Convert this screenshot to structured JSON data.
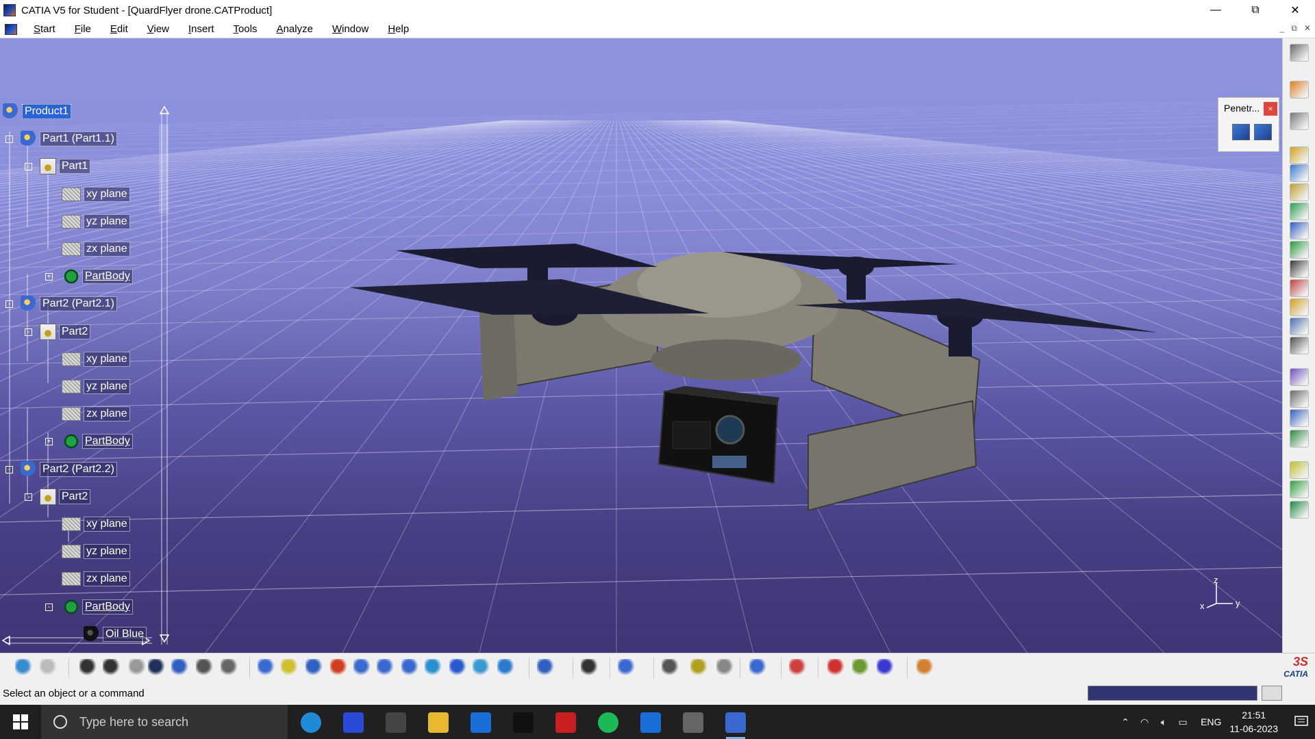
{
  "window": {
    "title": "CATIA V5 for Student - [QuardFlyer drone.CATProduct]",
    "minimize": "—",
    "restore": "⧉",
    "close": "✕"
  },
  "menu": {
    "items": [
      "Start",
      "File",
      "Edit",
      "View",
      "Insert",
      "Tools",
      "Analyze",
      "Window",
      "Help"
    ],
    "doc_minimize": "_",
    "doc_restore": "⧉",
    "doc_close": "✕"
  },
  "tree": {
    "nodes": [
      {
        "label": "Product1",
        "icon": "product-icon",
        "selected": true
      },
      {
        "label": "Part1 (Part1.1)",
        "icon": "product-icon"
      },
      {
        "label": "Part1",
        "icon": "part-icon"
      },
      {
        "label": "xy plane",
        "icon": "plane-icon"
      },
      {
        "label": "yz plane",
        "icon": "plane-icon"
      },
      {
        "label": "zx plane",
        "icon": "plane-icon"
      },
      {
        "label": "PartBody",
        "icon": "partbody-icon"
      },
      {
        "label": "Part2 (Part2.1)",
        "icon": "product-icon"
      },
      {
        "label": "Part2",
        "icon": "part-icon"
      },
      {
        "label": "xy plane",
        "icon": "plane-icon"
      },
      {
        "label": "yz plane",
        "icon": "plane-icon"
      },
      {
        "label": "zx plane",
        "icon": "plane-icon"
      },
      {
        "label": "PartBody",
        "icon": "partbody-icon"
      },
      {
        "label": "Part2 (Part2.2)",
        "icon": "product-icon"
      },
      {
        "label": "Part2",
        "icon": "part-icon"
      },
      {
        "label": "xy plane",
        "icon": "plane-icon"
      },
      {
        "label": "yz plane",
        "icon": "plane-icon"
      },
      {
        "label": "zx plane",
        "icon": "plane-icon"
      },
      {
        "label": "PartBody",
        "icon": "partbody-icon"
      },
      {
        "label": "Oil Blue",
        "icon": "material-icon"
      }
    ]
  },
  "penetration_panel": {
    "title": "Penetr...",
    "close": "×"
  },
  "compass": {
    "z": "z",
    "x": "x",
    "y": "y"
  },
  "status": {
    "message": "Select an object or a command"
  },
  "taskbar": {
    "search_placeholder": "Type here to search",
    "apps": [
      "edge-icon",
      "autodesk-icon",
      "unity-icon",
      "file-explorer-icon",
      "skype-icon",
      "catia-ds-icon",
      "solidworks-icon",
      "spotify-icon",
      "window-app-icon",
      "workbench-icon",
      "catia-active-icon"
    ],
    "language": "ENG",
    "time": "21:51",
    "date": "11-06-2023"
  },
  "brand": {
    "logo_text": "CATIA",
    "accent": "#2a62d8",
    "viewport_top": "#8e93de",
    "viewport_bottom": "#3f3575"
  }
}
